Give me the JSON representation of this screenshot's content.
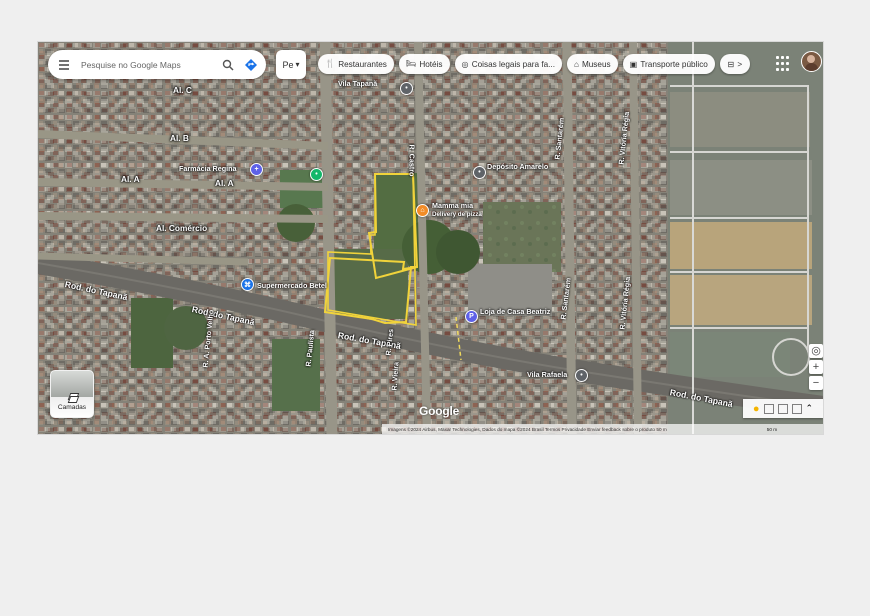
{
  "colors": {
    "property_outline": "#f1d33b",
    "search_direction": "#1a73e8",
    "pin_green": "#12b76a",
    "pin_orange": "#f28c28",
    "pin_blue": "#1a73e8",
    "pin_gray": "#5f6368",
    "pin_purple": "#5e61e8"
  },
  "search": {
    "placeholder": "Pesquise no Google Maps",
    "menu_icon": "menu-icon",
    "search_icon": "search-icon",
    "directions_icon": "directions-icon"
  },
  "mode_box": {
    "label": "Pe"
  },
  "chips": [
    {
      "icon": "restaurant-icon",
      "label": "Restaurantes"
    },
    {
      "icon": "hotel-icon",
      "label": "Hotéis"
    },
    {
      "icon": "camera-icon",
      "label": "Coisas legais para fa..."
    },
    {
      "icon": "museum-icon",
      "label": "Museus"
    },
    {
      "icon": "transit-icon",
      "label": "Transporte público"
    },
    {
      "icon": "more-icon",
      "label": ">"
    }
  ],
  "labels": {
    "al_c": "Al. C",
    "al_b": "Al. B",
    "al_a_1": "Al. A",
    "al_a_2": "Al. A",
    "al_comercio": "Al. Comércio",
    "rod_tapana_1": "Rod. do Tapanã",
    "rod_tapana_2": "Rod. do Tapanã",
    "rod_tapana_3": "Rod. do Tapanã",
    "rod_tapana_4": "Rod. do Tapanã",
    "r_santarem_1": "R. Santarém",
    "r_santarem_2": "R. Santarém",
    "r_vitoria_regia_1": "R. Vitória Régia",
    "r_vitoria_regia_2": "R. Vitória Régia",
    "rua_castro": "R. Castro",
    "rua_pires": "R. Pires",
    "rua_vieira": "R. Vieira",
    "r_a_porto_velho": "R. A. Porto Velho",
    "r_paulista": "R. Paulista",
    "supermarket": "Supermercado Betel",
    "mamma_mia": "Mamma mia",
    "mamma_mia_sub": "Delivery de pizza",
    "pharmacy": "Farmácia Regina",
    "depot": "Depósito Amarelo",
    "shop_left": "Loja de Casa Beatriz",
    "vila": "Vila Rafaela",
    "top_poi": "Vila Tapanã",
    "google": "Google",
    "layers": "Camadas",
    "footer": "Imagens ©2024 Airbus, Maxar Technologies, Dados do mapa ©2024 Brasil Termos Privacidade Enviar feedback sobre o produto 50 m",
    "scale": "50 m"
  },
  "controls": {
    "location_icon": "my-location-icon",
    "zoom_in": "+",
    "zoom_out": "−"
  }
}
